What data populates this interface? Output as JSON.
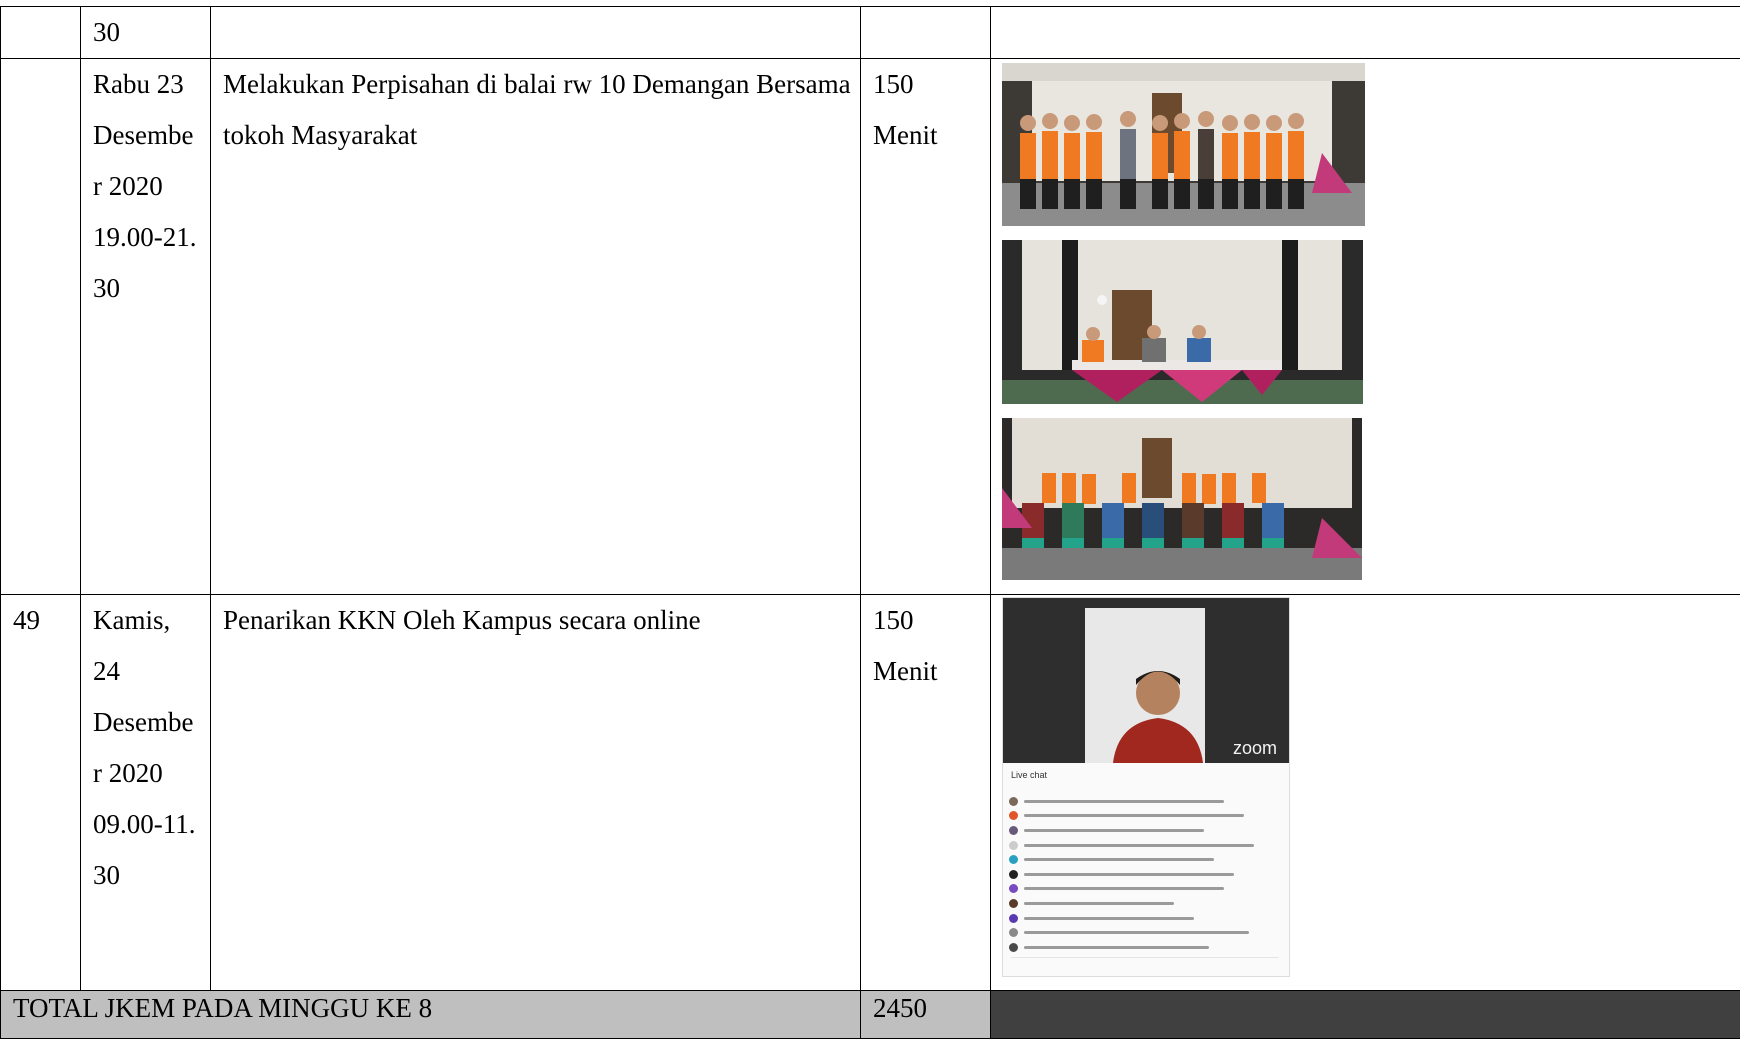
{
  "rows": [
    {
      "no": "",
      "date_lines": [
        "30"
      ],
      "activity_lines": [],
      "duration_lines": []
    },
    {
      "no": "",
      "date_lines": [
        "Rabu 23",
        "Desembe",
        "r 2020",
        "19.00-21.",
        "30"
      ],
      "activity_lines": [
        "Melakukan Perpisahan di balai rw 10 Demangan Bersama",
        "tokoh Masyarakat"
      ],
      "duration_lines": [
        "150",
        "Menit"
      ]
    },
    {
      "no": "49",
      "date_lines": [
        "Kamis,",
        "24",
        "Desembe",
        "r 2020",
        "09.00-11.",
        "30"
      ],
      "activity_lines": [
        "Penarikan KKN Oleh Kampus secara online"
      ],
      "duration_lines": [
        "150",
        "Menit"
      ]
    }
  ],
  "total": {
    "label": "TOTAL JKEM PADA MINGGU KE 8",
    "value": "2450"
  },
  "zoom": {
    "logo": "zoom",
    "chat_title": "Live chat"
  },
  "colors": {
    "total_bg": "#bfbfbf",
    "dark_cell": "#404040",
    "vest_orange": "#f07a22"
  }
}
